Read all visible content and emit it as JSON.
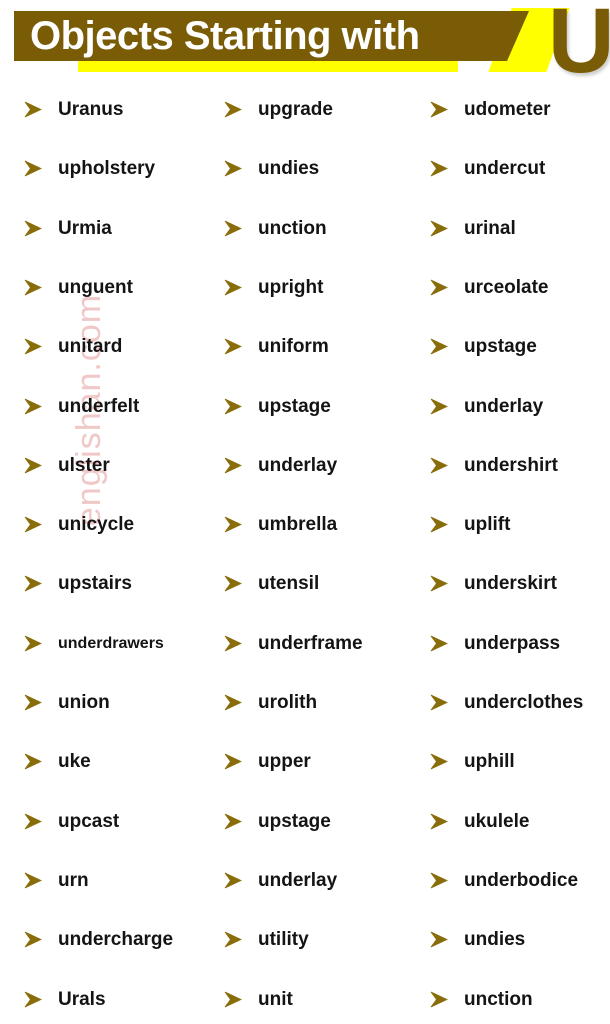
{
  "header": {
    "title": "Objects Starting with",
    "letter": "U",
    "brand_brown": "#7a5c06",
    "accent_yellow": "#ffff00",
    "title_color": "#ffffff"
  },
  "watermark": {
    "text": "englishan.com",
    "color": "#f0c8c8"
  },
  "bullet": {
    "icon": "arrowhead-bullet-icon",
    "color": "#8a6d0b"
  },
  "columns": [
    {
      "id": "column-1",
      "words": [
        {
          "text": "Uranus",
          "size": "normal"
        },
        {
          "text": "upholstery",
          "size": "normal"
        },
        {
          "text": "Urmia",
          "size": "normal"
        },
        {
          "text": "unguent",
          "size": "normal"
        },
        {
          "text": "unitard",
          "size": "normal"
        },
        {
          "text": "underfelt",
          "size": "normal"
        },
        {
          "text": "ulster",
          "size": "normal"
        },
        {
          "text": "unicycle",
          "size": "normal"
        },
        {
          "text": "upstairs",
          "size": "normal"
        },
        {
          "text": "underdrawers",
          "size": "small"
        },
        {
          "text": "union",
          "size": "normal"
        },
        {
          "text": "uke",
          "size": "normal"
        },
        {
          "text": "upcast",
          "size": "normal"
        },
        {
          "text": "urn",
          "size": "normal"
        },
        {
          "text": "undercharge",
          "size": "normal"
        },
        {
          "text": "Urals",
          "size": "normal"
        }
      ]
    },
    {
      "id": "column-2",
      "words": [
        {
          "text": "upgrade",
          "size": "normal"
        },
        {
          "text": "undies",
          "size": "normal"
        },
        {
          "text": "unction",
          "size": "normal"
        },
        {
          "text": "upright",
          "size": "normal"
        },
        {
          "text": "uniform",
          "size": "normal"
        },
        {
          "text": "upstage",
          "size": "normal"
        },
        {
          "text": "underlay",
          "size": "normal"
        },
        {
          "text": "umbrella",
          "size": "normal"
        },
        {
          "text": "utensil",
          "size": "normal"
        },
        {
          "text": "underframe",
          "size": "normal"
        },
        {
          "text": "urolith",
          "size": "normal"
        },
        {
          "text": "upper",
          "size": "normal"
        },
        {
          "text": "upstage",
          "size": "normal"
        },
        {
          "text": "underlay",
          "size": "normal"
        },
        {
          "text": "utility",
          "size": "normal"
        },
        {
          "text": "unit",
          "size": "normal"
        }
      ]
    },
    {
      "id": "column-3",
      "words": [
        {
          "text": "udometer",
          "size": "normal"
        },
        {
          "text": "undercut",
          "size": "normal"
        },
        {
          "text": "urinal",
          "size": "normal"
        },
        {
          "text": "urceolate",
          "size": "normal"
        },
        {
          "text": "upstage",
          "size": "normal"
        },
        {
          "text": "underlay",
          "size": "normal"
        },
        {
          "text": "undershirt",
          "size": "normal"
        },
        {
          "text": "uplift",
          "size": "normal"
        },
        {
          "text": "underskirt",
          "size": "normal"
        },
        {
          "text": "underpass",
          "size": "normal"
        },
        {
          "text": "underclothes",
          "size": "normal"
        },
        {
          "text": "uphill",
          "size": "normal"
        },
        {
          "text": "ukulele",
          "size": "normal"
        },
        {
          "text": "underbodice",
          "size": "normal"
        },
        {
          "text": "undies",
          "size": "normal"
        },
        {
          "text": "unction",
          "size": "normal"
        }
      ]
    }
  ]
}
